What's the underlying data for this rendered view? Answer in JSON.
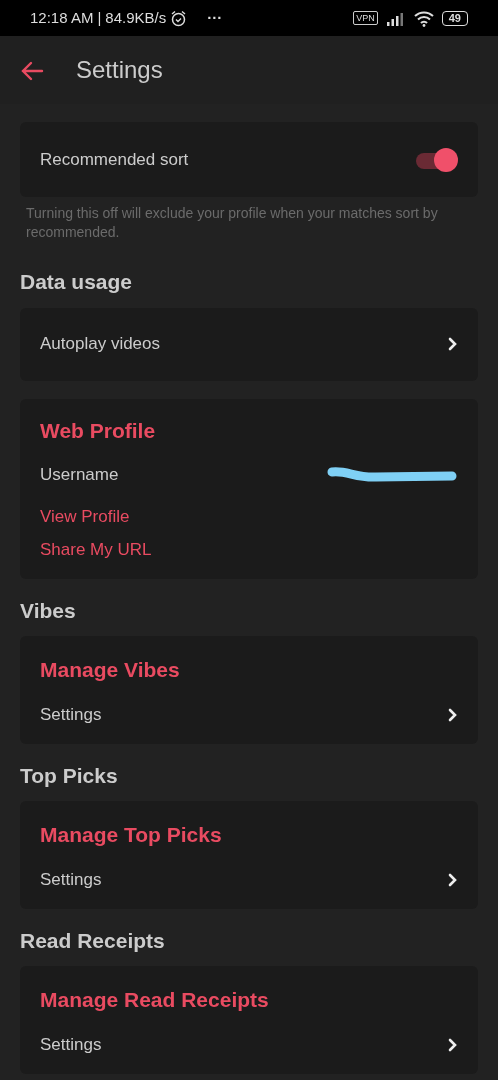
{
  "status_bar": {
    "time": "12:18 AM",
    "separator": "|",
    "speed": "84.9KB/s",
    "more": "···",
    "vpn": "VPN",
    "battery": "49"
  },
  "header": {
    "title": "Settings"
  },
  "items": [
    {
      "kind": "toggle_card",
      "label": "Recommended sort",
      "on": true
    },
    {
      "kind": "note",
      "text": "Turning this off will exclude your profile when your matches sort by recommended."
    },
    {
      "kind": "heading",
      "text": "Data usage"
    },
    {
      "kind": "link_card",
      "label": "Autoplay videos"
    },
    {
      "kind": "profile_card",
      "title": "Web Profile",
      "username_label": "Username",
      "links": [
        "View Profile",
        "Share My URL"
      ]
    },
    {
      "kind": "heading",
      "text": "Vibes"
    },
    {
      "kind": "manage_card",
      "title": "Manage Vibes",
      "label": "Settings"
    },
    {
      "kind": "heading",
      "text": "Top Picks"
    },
    {
      "kind": "manage_card",
      "title": "Manage Top Picks",
      "label": "Settings"
    },
    {
      "kind": "heading",
      "text": "Read Receipts"
    },
    {
      "kind": "manage_card",
      "title": "Manage Read Receipts",
      "label": "Settings"
    }
  ]
}
